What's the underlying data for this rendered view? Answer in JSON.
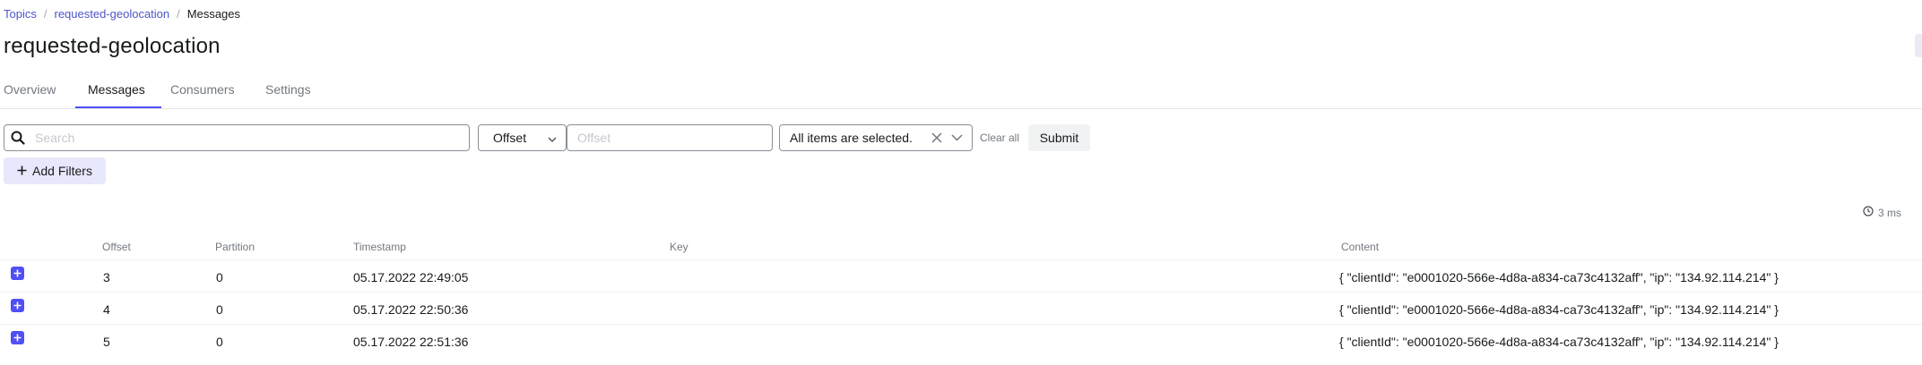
{
  "breadcrumb": {
    "items": [
      "Topics",
      "requested-geolocation"
    ],
    "current": "Messages",
    "separator": "/"
  },
  "page_title": "requested-geolocation",
  "tabs": [
    {
      "label": "Overview",
      "active": false
    },
    {
      "label": "Messages",
      "active": true
    },
    {
      "label": "Consumers",
      "active": false
    },
    {
      "label": "Settings",
      "active": false
    }
  ],
  "filters": {
    "search_placeholder": "Search",
    "seek_type": "Offset",
    "offset_placeholder": "Offset",
    "partitions_summary": "All items are selected.",
    "clear_all": "Clear all",
    "submit": "Submit",
    "add_filters": "Add Filters"
  },
  "elapsed": "3 ms",
  "table": {
    "columns": [
      "Offset",
      "Partition",
      "Timestamp",
      "Key",
      "Content"
    ],
    "rows": [
      {
        "offset": "3",
        "partition": "0",
        "timestamp": "05.17.2022 22:49:05",
        "key": "",
        "content": "{ \"clientId\": \"e0001020-566e-4d8a-a834-ca73c4132aff\", \"ip\": \"134.92.114.214\" }"
      },
      {
        "offset": "4",
        "partition": "0",
        "timestamp": "05.17.2022 22:50:36",
        "key": "",
        "content": "{ \"clientId\": \"e0001020-566e-4d8a-a834-ca73c4132aff\", \"ip\": \"134.92.114.214\" }"
      },
      {
        "offset": "5",
        "partition": "0",
        "timestamp": "05.17.2022 22:51:36",
        "key": "",
        "content": "{ \"clientId\": \"e0001020-566e-4d8a-a834-ca73c4132aff\", \"ip\": \"134.92.114.214\" }"
      }
    ]
  },
  "colors": {
    "accent": "#4f4ff5",
    "link": "#4c56c8",
    "muted": "#73787f"
  }
}
